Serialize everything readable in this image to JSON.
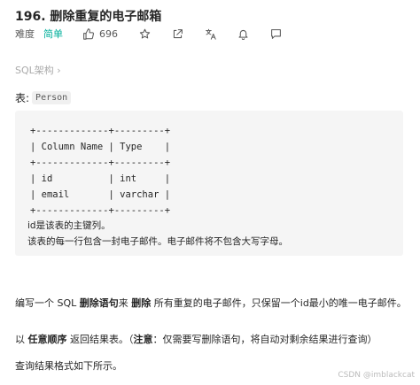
{
  "problem": {
    "title": "196. 删除重复的电子邮箱",
    "difficulty_label": "难度",
    "difficulty_value": "简单",
    "likes": "696"
  },
  "breadcrumb": {
    "label": "SQL架构 ›"
  },
  "table_intro": {
    "label": "表:",
    "name": "Person"
  },
  "schema": {
    "lines": [
      "+-------------+---------+",
      "| Column Name | Type    |",
      "+-------------+---------+",
      "| id          | int     |",
      "| email       | varchar |",
      "+-------------+---------+"
    ],
    "note1": "id是该表的主键列。",
    "note2": "该表的每一行包含一封电子邮件。电子邮件将不包含大写字母。"
  },
  "description": {
    "p1_a": "编写一个 SQL ",
    "p1_b": "删除语句",
    "p1_c": "来 ",
    "p1_d": "删除",
    "p1_e": " 所有重复的电子邮件，只保留一个id最小的唯一电子邮件。",
    "p2_a": "以 ",
    "p2_b": "任意顺序",
    "p2_c": " 返回结果表。（",
    "p2_d": "注意",
    "p2_e": "：仅需要写删除语句，将自动对剩余结果进行查询）",
    "p3": "查询结果格式如下所示。"
  },
  "watermark": "CSDN @imblackcat",
  "icons": [
    "thumbs-up-icon",
    "star-icon",
    "share-icon",
    "translate-icon",
    "bell-icon",
    "feedback-icon"
  ]
}
